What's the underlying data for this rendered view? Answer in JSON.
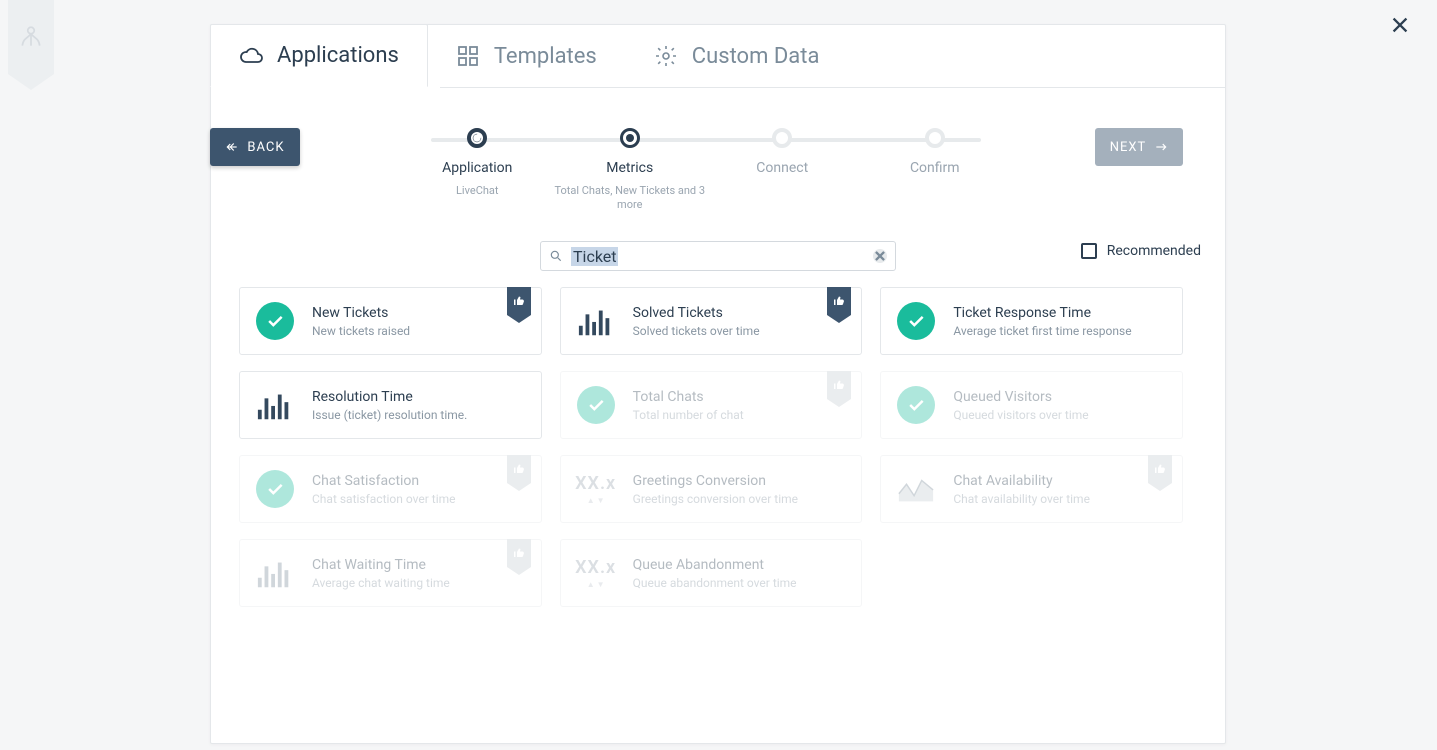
{
  "tabs": {
    "applications": "Applications",
    "templates": "Templates",
    "custom": "Custom Data"
  },
  "nav": {
    "back": "BACK",
    "next": "NEXT"
  },
  "stepper": {
    "step1": {
      "label": "Application",
      "sub": "LiveChat"
    },
    "step2": {
      "label": "Metrics",
      "sub": "Total Chats, New Tickets and 3 more"
    },
    "step3": {
      "label": "Connect"
    },
    "step4": {
      "label": "Confirm"
    }
  },
  "search": {
    "value": "Ticket",
    "placeholder": ""
  },
  "recommended_label": "Recommended",
  "metrics": {
    "new_tickets": {
      "title": "New Tickets",
      "sub": "New tickets raised"
    },
    "solved_tickets": {
      "title": "Solved Tickets",
      "sub": "Solved tickets over time"
    },
    "response_time": {
      "title": "Ticket Response Time",
      "sub": "Average ticket first time response"
    },
    "resolution_time": {
      "title": "Resolution Time",
      "sub": "Issue (ticket) resolution time."
    },
    "total_chats": {
      "title": "Total Chats",
      "sub": "Total number of chat"
    },
    "queued_visitors": {
      "title": "Queued Visitors",
      "sub": "Queued visitors over time"
    },
    "chat_satisfaction": {
      "title": "Chat Satisfaction",
      "sub": "Chat satisfaction over time"
    },
    "greetings": {
      "title": "Greetings Conversion",
      "sub": "Greetings conversion over time"
    },
    "chat_availability": {
      "title": "Chat Availability",
      "sub": "Chat availability over time"
    },
    "chat_waiting": {
      "title": "Chat Waiting Time",
      "sub": "Average chat waiting time"
    },
    "queue_abandon": {
      "title": "Queue Abandonment",
      "sub": "Queue abandonment over time"
    }
  },
  "xx_label": "XX.x"
}
